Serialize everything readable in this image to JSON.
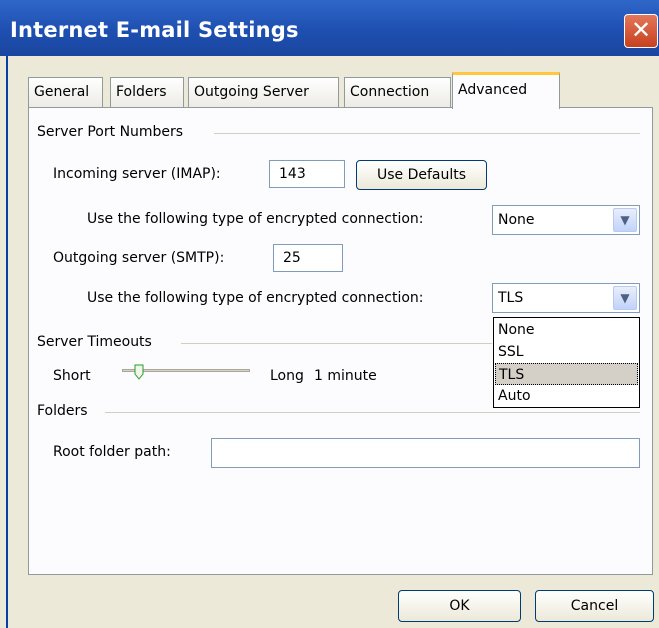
{
  "window": {
    "title": "Internet E-mail Settings",
    "close_glyph": "✕"
  },
  "tabs": [
    {
      "label": "General",
      "active": false
    },
    {
      "label": "Folders",
      "active": false
    },
    {
      "label": "Outgoing Server",
      "active": false
    },
    {
      "label": "Connection",
      "active": false
    },
    {
      "label": "Advanced",
      "active": true
    }
  ],
  "port_numbers": {
    "group_label": "Server Port Numbers",
    "incoming_label": "Incoming server (IMAP):",
    "incoming_value": "143",
    "use_defaults_label": "Use Defaults",
    "incoming_enc_label": "Use the following type of encrypted connection:",
    "incoming_enc_value": "None",
    "outgoing_label": "Outgoing server (SMTP):",
    "outgoing_value": "25",
    "outgoing_enc_label": "Use the following type of encrypted connection:",
    "outgoing_enc_value": "TLS"
  },
  "encryption_dropdown": {
    "options": [
      "None",
      "SSL",
      "TLS",
      "Auto"
    ],
    "selected": "TLS"
  },
  "timeouts": {
    "group_label": "Server Timeouts",
    "short_label": "Short",
    "long_label": "Long",
    "value_label": "1 minute",
    "slider_level": 0.1
  },
  "folders": {
    "group_label": "Folders",
    "root_label": "Root folder path:",
    "root_value": ""
  },
  "footer": {
    "ok_label": "OK",
    "cancel_label": "Cancel"
  },
  "colors": {
    "titlebar": "#2159c0",
    "dialog_bg": "#ece9d8",
    "panel_bg": "#fcfcfe",
    "tab_highlight": "#ffc83c"
  }
}
